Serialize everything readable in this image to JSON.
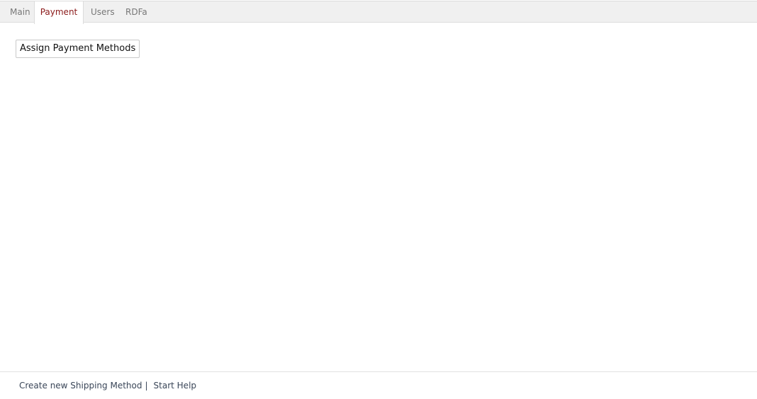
{
  "tabs": [
    {
      "label": "Main",
      "active": false
    },
    {
      "label": "Payment",
      "active": true
    },
    {
      "label": "Users",
      "active": false
    },
    {
      "label": "RDFa",
      "active": false
    }
  ],
  "main": {
    "assign_button_label": "Assign Payment Methods"
  },
  "footer": {
    "create_link": "Create new Shipping Method",
    "separator": "|",
    "help_link": "Start Help"
  },
  "colors": {
    "active_tab_text": "#8b1a1a",
    "inactive_tab_text": "#777777",
    "tabbar_bg": "#f0f0f0",
    "footer_link": "#3a4658"
  }
}
